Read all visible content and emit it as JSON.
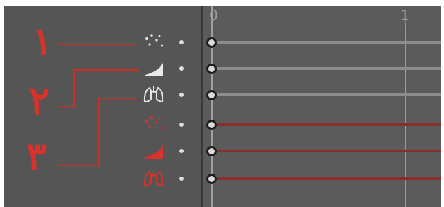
{
  "ruler": {
    "start": "0",
    "mark": "1"
  },
  "labels": [
    "۱",
    "۲",
    "۳"
  ],
  "channels": [
    {
      "icon": "particles-icon",
      "color": "white"
    },
    {
      "icon": "curve-icon",
      "color": "white"
    },
    {
      "icon": "lungs-icon",
      "color": "white"
    },
    {
      "icon": "particles-icon",
      "color": "red"
    },
    {
      "icon": "curve-icon",
      "color": "red"
    },
    {
      "icon": "lungs-icon",
      "color": "red"
    }
  ],
  "colors": {
    "white_track": "#8c8c8c",
    "red_track": "#8a2e2a",
    "annotation": "#d8322a",
    "panel_bg": "#555555"
  }
}
